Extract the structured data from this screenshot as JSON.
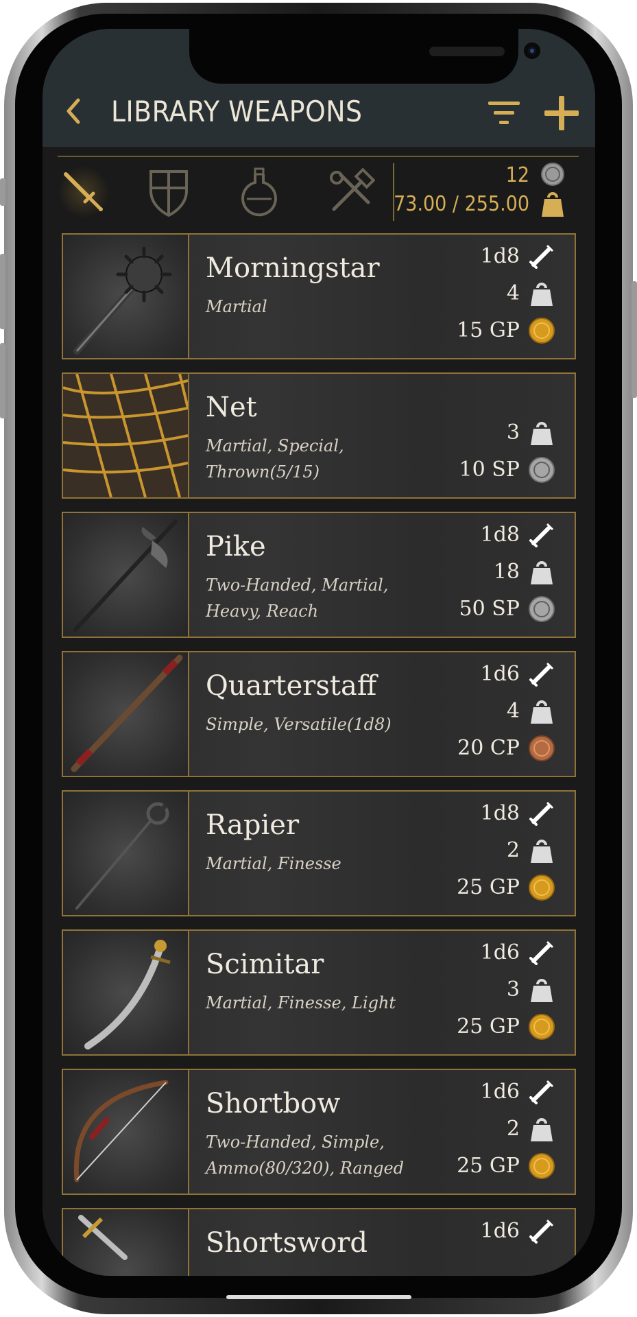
{
  "header": {
    "title": "LIBRARY WEAPONS"
  },
  "tabs": [
    {
      "name": "weapons",
      "active": true
    },
    {
      "name": "armor",
      "active": false
    },
    {
      "name": "potions",
      "active": false
    },
    {
      "name": "tools",
      "active": false
    }
  ],
  "summary": {
    "count": "12",
    "weight": "73.00 / 255.00"
  },
  "colors": {
    "accent": "#d6ae55",
    "card_border": "#8f7338",
    "header_bg": "#293034",
    "text": "#f0ebe0"
  },
  "weapons": [
    {
      "name": "Morningstar",
      "props_1": "Martial",
      "props_2": "",
      "damage": "1d8",
      "weight": "4",
      "cost": "15 GP",
      "coin": "gold-coin-icon",
      "img": "morningstar"
    },
    {
      "name": "Net",
      "props_1": "Martial, Special,",
      "props_2": "Thrown(5/15)",
      "damage": "",
      "weight": "3",
      "cost": "10 SP",
      "coin": "silver-coin-icon",
      "img": "net"
    },
    {
      "name": "Pike",
      "props_1": "Two-Handed, Martial,",
      "props_2": "Heavy, Reach",
      "damage": "1d8",
      "weight": "18",
      "cost": "50 SP",
      "coin": "silver-coin-icon",
      "img": "pike"
    },
    {
      "name": "Quarterstaff",
      "props_1": "Simple, Versatile(1d8)",
      "props_2": "",
      "damage": "1d6",
      "weight": "4",
      "cost": "20 CP",
      "coin": "copper-coin-icon",
      "img": "staff"
    },
    {
      "name": "Rapier",
      "props_1": "Martial, Finesse",
      "props_2": "",
      "damage": "1d8",
      "weight": "2",
      "cost": "25 GP",
      "coin": "gold-coin-icon",
      "img": "rapier"
    },
    {
      "name": "Scimitar",
      "props_1": "Martial, Finesse, Light",
      "props_2": "",
      "damage": "1d6",
      "weight": "3",
      "cost": "25 GP",
      "coin": "gold-coin-icon",
      "img": "scimitar"
    },
    {
      "name": "Shortbow",
      "props_1": "Two-Handed, Simple,",
      "props_2": "Ammo(80/320), Ranged",
      "damage": "1d6",
      "weight": "2",
      "cost": "25 GP",
      "coin": "gold-coin-icon",
      "img": "bow"
    },
    {
      "name": "Shortsword",
      "props_1": "",
      "props_2": "",
      "damage": "1d6",
      "weight": "",
      "cost": "",
      "coin": "",
      "img": "shortsword"
    }
  ]
}
